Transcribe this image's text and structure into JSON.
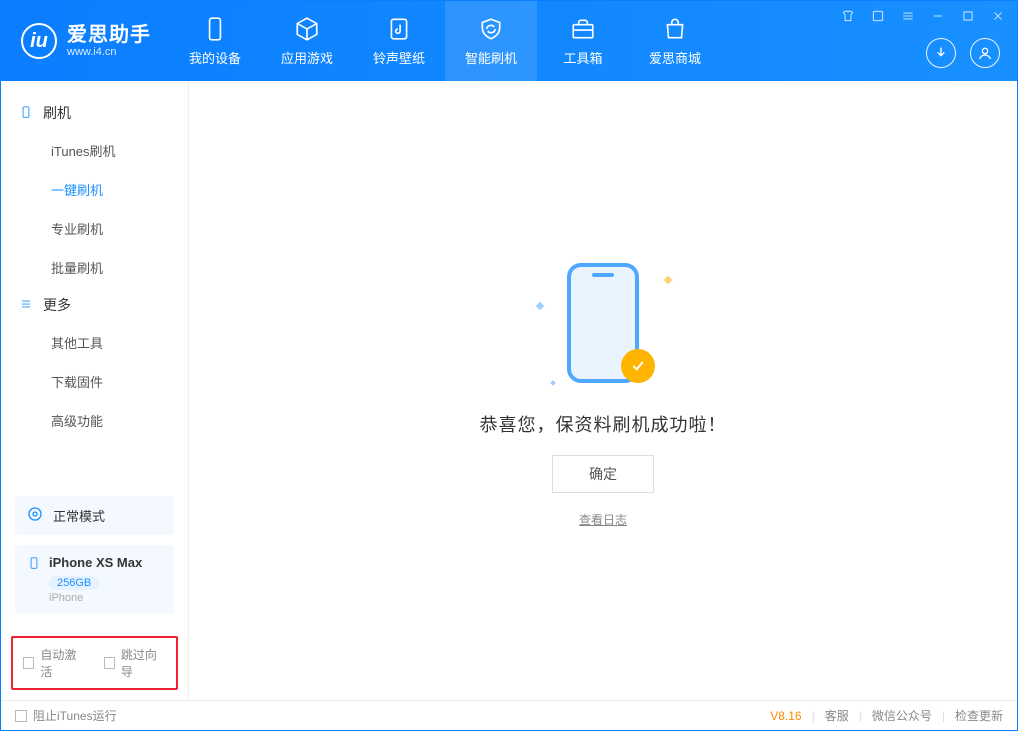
{
  "app": {
    "name_cn": "爱思助手",
    "name_en": "www.i4.cn"
  },
  "tabs": [
    {
      "label": "我的设备"
    },
    {
      "label": "应用游戏"
    },
    {
      "label": "铃声壁纸"
    },
    {
      "label": "智能刷机"
    },
    {
      "label": "工具箱"
    },
    {
      "label": "爱思商城"
    }
  ],
  "sidebar": {
    "section_a": {
      "title": "刷机",
      "items": [
        "iTunes刷机",
        "一键刷机",
        "专业刷机",
        "批量刷机"
      ]
    },
    "section_b": {
      "title": "更多",
      "items": [
        "其他工具",
        "下载固件",
        "高级功能"
      ]
    },
    "mode": "正常模式",
    "device": {
      "name": "iPhone XS Max",
      "capacity": "256GB",
      "type": "iPhone"
    },
    "opt_auto_activate": "自动激活",
    "opt_skip_guide": "跳过向导"
  },
  "main": {
    "result": "恭喜您，保资料刷机成功啦！",
    "confirm": "确定",
    "view_log": "查看日志"
  },
  "status": {
    "block_itunes": "阻止iTunes运行",
    "version": "V8.16",
    "cs": "客服",
    "wechat": "微信公众号",
    "update": "检查更新"
  }
}
